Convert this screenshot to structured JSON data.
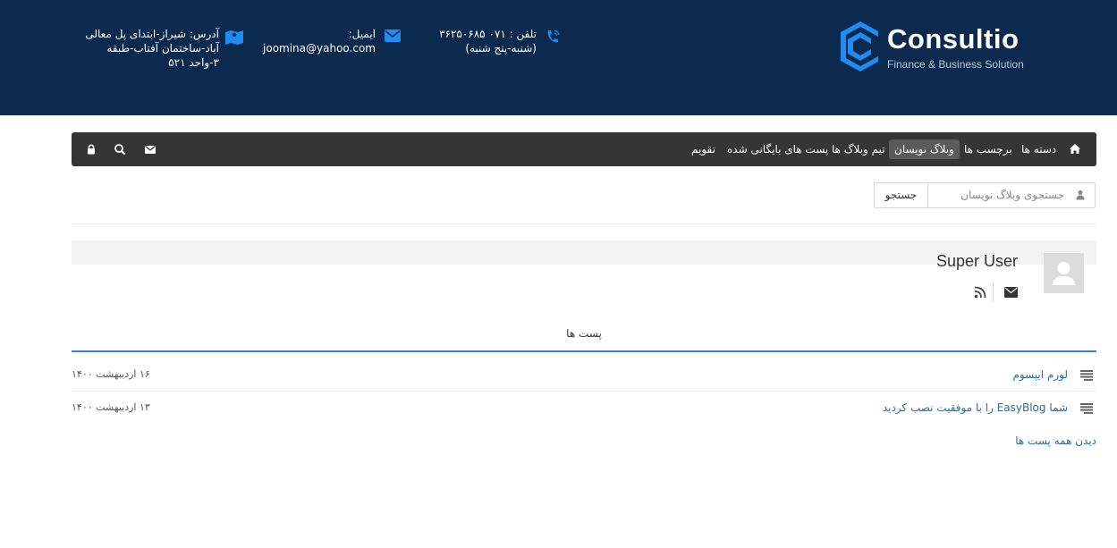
{
  "header": {
    "logo": {
      "name": "Consultio",
      "tagline": "Finance & Business Solution",
      "color": "#1e8cf0"
    },
    "phone": {
      "icon": "phone-icon",
      "line1": "تلفن : ۰۷۱ ۳۶۲۵۰۶۸۵",
      "line2": "(شنبه-پنج شنبه)"
    },
    "email": {
      "icon": "envelope-icon",
      "line1": "ایمیل:",
      "line2": "joomina@yahoo.com"
    },
    "address": {
      "icon": "map-icon",
      "line1": "آدرس: شیراز-ابتدای پل معالی",
      "line2": "آباد-ساختمان آفتاب-طبقه",
      "line3": "۳-واحد ۵۲۱"
    }
  },
  "nav": {
    "home_icon": "home-icon",
    "items": [
      {
        "label": "دسته ها",
        "active": false
      },
      {
        "label": "برچسب ها",
        "active": false
      },
      {
        "label": "وبلاگ نویسان",
        "active": true
      },
      {
        "label": "تیم وبلاگ ها",
        "active": false
      },
      {
        "label": "پست های بایگانی شده",
        "active": false
      },
      {
        "label": "تقویم",
        "active": false
      }
    ],
    "tool_icons": [
      "envelope-icon",
      "search-icon",
      "lock-icon"
    ]
  },
  "search": {
    "placeholder": "جستجوی وبلاگ نویسان",
    "button": "جستجو"
  },
  "author": {
    "name": "Super User"
  },
  "posts_tab": {
    "label": "پست ها"
  },
  "posts": [
    {
      "title": "لورم ایپسوم",
      "date": "۱۶ اردیبهشت ۱۴۰۰"
    },
    {
      "title": "شما EasyBlog را با موفقیت نصب کردید",
      "date": "۱۳ اردیبهشت ۱۴۰۰"
    }
  ],
  "view_all": "دیدن همه پست ها",
  "colors": {
    "header_bg": "#0b2a4e",
    "accent": "#1e8cf0",
    "nav_bg": "#353535",
    "link": "#2a6aa8"
  }
}
